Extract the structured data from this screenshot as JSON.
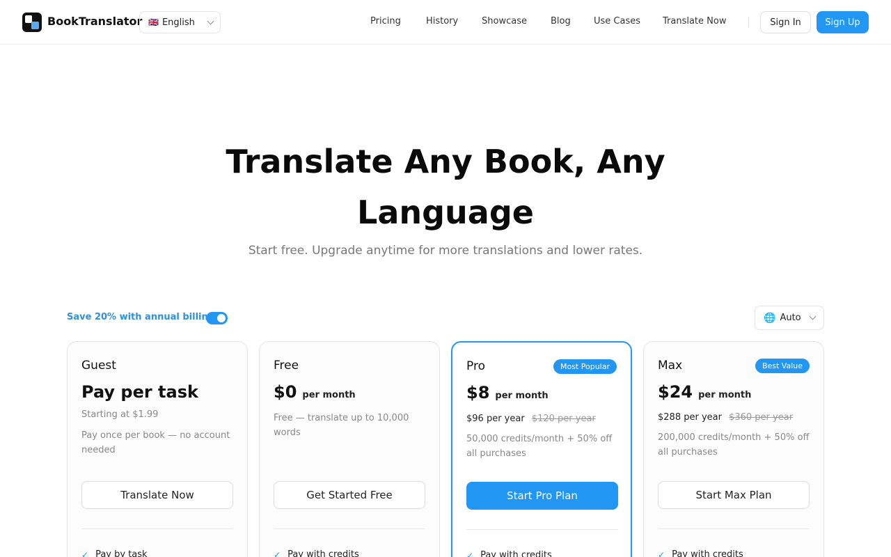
{
  "header": {
    "brand": "BookTranslator",
    "language": {
      "flag": "🇬🇧",
      "label": "English"
    },
    "nav": [
      "Pricing",
      "History",
      "Showcase",
      "Blog",
      "Use Cases",
      "Translate Now"
    ],
    "sign_in": "Sign In",
    "sign_up": "Sign Up"
  },
  "hero": {
    "title": "Translate Any Book, Any Language",
    "subtitle": "Start free. Upgrade anytime for more translations and lower rates."
  },
  "billing": {
    "annual_label": "Save 20% with annual billing",
    "annual_enabled": true,
    "currency_label": "Auto"
  },
  "plans": [
    {
      "name": "Guest",
      "price": "Pay per task",
      "sub": "Starting at $1.99",
      "description": "Pay once per book — no account needed",
      "cta": "Translate Now",
      "feature": "Pay by task"
    },
    {
      "name": "Free",
      "price": "$0",
      "per": "per month",
      "description": "Free — translate up to 10,000 words",
      "cta": "Get Started Free",
      "feature": "Pay with credits"
    },
    {
      "name": "Pro",
      "badge": "Most Popular",
      "price": "$8",
      "per": "per month",
      "yearly": "$96 per year",
      "yearly_original": "$120 per year",
      "description": "50,000 credits/month + 50% off all purchases",
      "cta": "Start Pro Plan",
      "feature": "Pay with credits"
    },
    {
      "name": "Max",
      "badge": "Best Value",
      "price": "$24",
      "per": "per month",
      "yearly": "$288 per year",
      "yearly_original": "$360 per year",
      "description": "200,000 credits/month + 50% off all purchases",
      "cta": "Start Max Plan",
      "feature": "Pay with credits"
    }
  ],
  "icons": {
    "check": "check-icon",
    "globe": "globe-icon",
    "chevron": "chevron-down-icon"
  },
  "colors": {
    "accent": "#2196f3",
    "text": "#111111",
    "muted": "#888888"
  }
}
